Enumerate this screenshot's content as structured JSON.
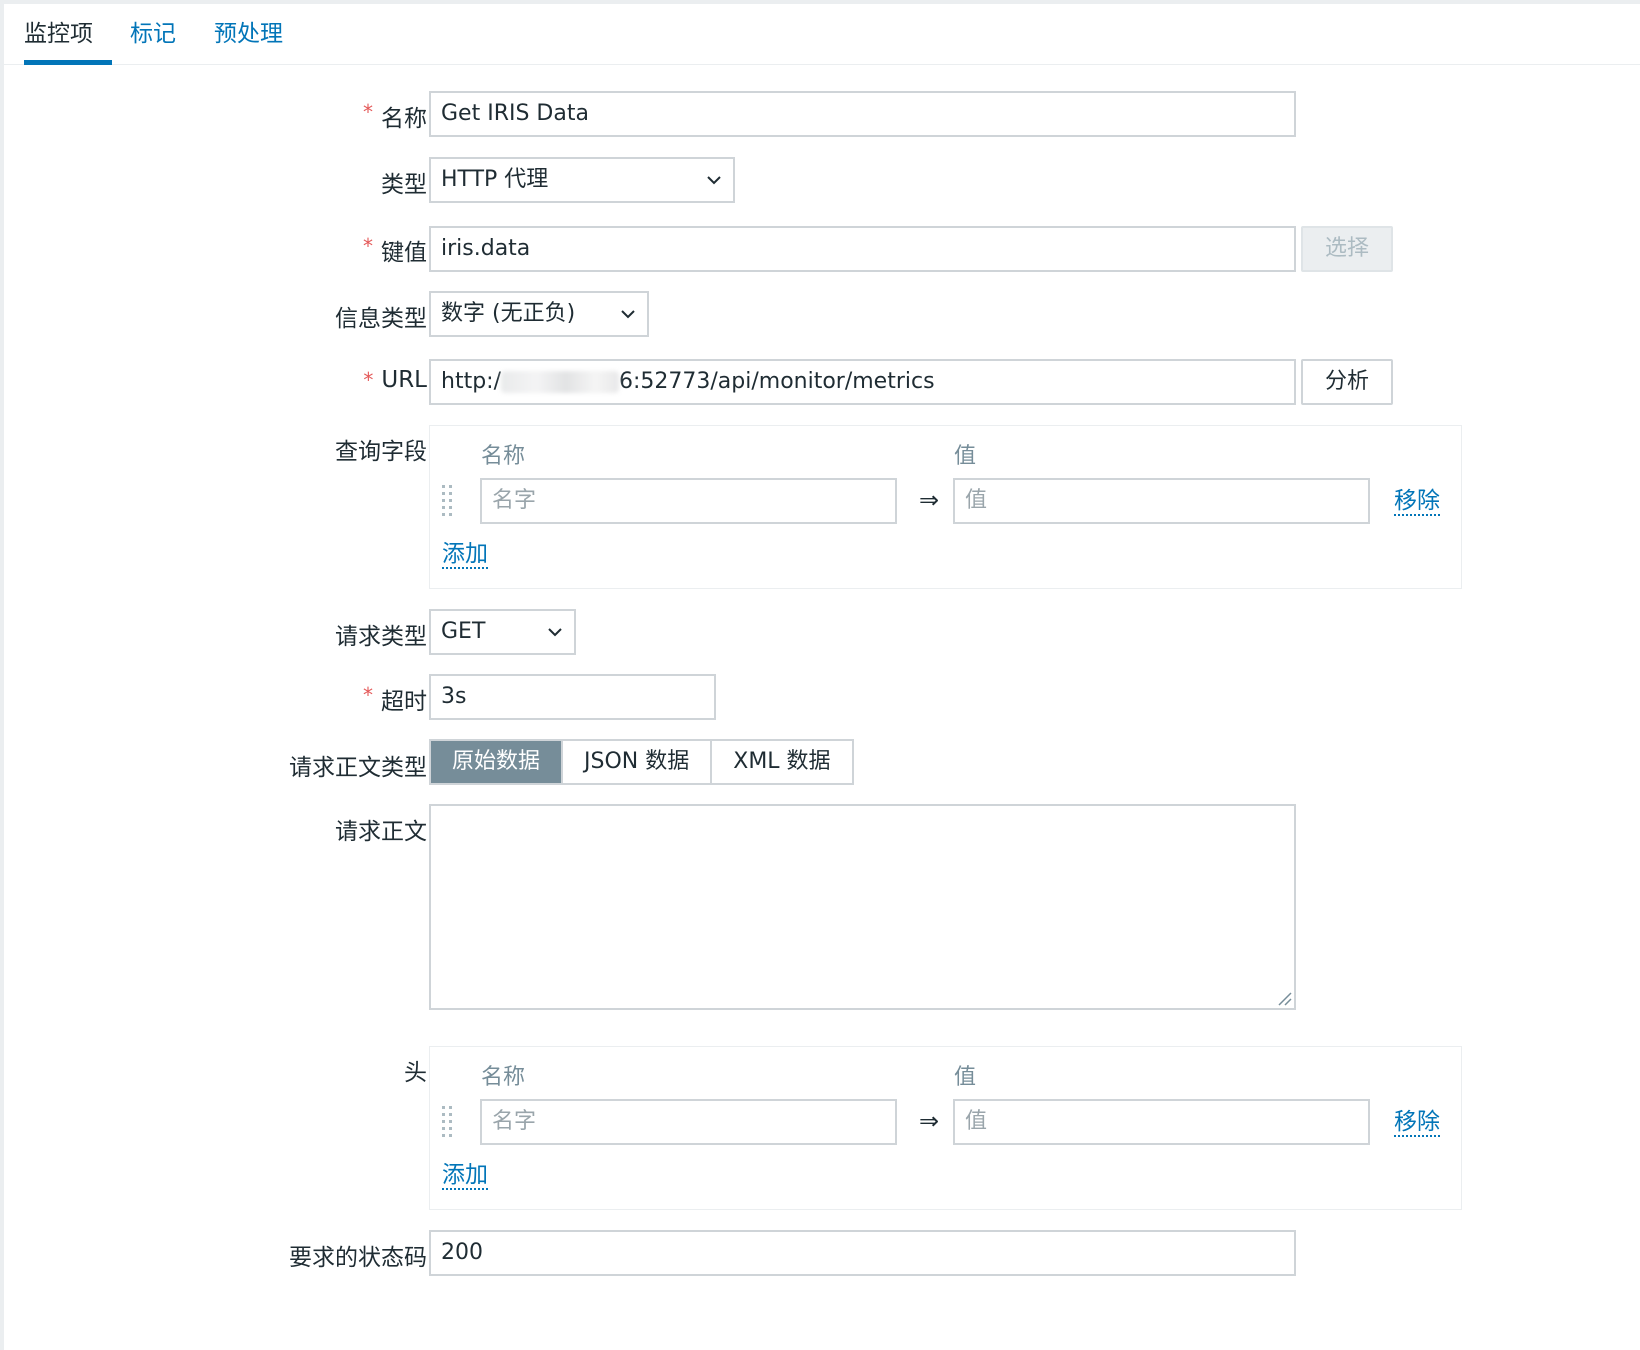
{
  "tabs": [
    {
      "label": "监控项",
      "active": true
    },
    {
      "label": "标记",
      "active": false
    },
    {
      "label": "预处理",
      "active": false
    }
  ],
  "form": {
    "name": {
      "label": "名称",
      "required": true,
      "value": "Get IRIS Data"
    },
    "type": {
      "label": "类型",
      "value": "HTTP 代理"
    },
    "key": {
      "label": "键值",
      "required": true,
      "value": "iris.data",
      "select_label": "选择"
    },
    "info_type": {
      "label": "信息类型",
      "value": "数字 (无正负)"
    },
    "url": {
      "label": "URL",
      "required": true,
      "value_prefix": "http:/",
      "value_suffix": "6:52773/api/monitor/metrics",
      "parse_label": "分析"
    },
    "query_fields": {
      "label": "查询字段",
      "col_name": "名称",
      "col_value": "值",
      "name_placeholder": "名字",
      "value_placeholder": "值",
      "remove_label": "移除",
      "add_label": "添加"
    },
    "request_type": {
      "label": "请求类型",
      "value": "GET"
    },
    "timeout": {
      "label": "超时",
      "required": true,
      "value": "3s"
    },
    "body_type": {
      "label": "请求正文类型",
      "options": [
        "原始数据",
        "JSON 数据",
        "XML 数据"
      ],
      "selected": "原始数据"
    },
    "body": {
      "label": "请求正文",
      "value": ""
    },
    "headers": {
      "label": "头",
      "col_name": "名称",
      "col_value": "值",
      "name_placeholder": "名字",
      "value_placeholder": "值",
      "remove_label": "移除",
      "add_label": "添加"
    },
    "status_codes": {
      "label": "要求的状态码",
      "value": "200"
    }
  },
  "colors": {
    "accent": "#0275b8",
    "required": "#e45959",
    "segment_active": "#768d99"
  },
  "icons": {
    "select_arrow": "chevron-down-icon",
    "drag_handle": "drag-handle-icon",
    "mapping_arrow": "⇒",
    "resize": "resize-handle-icon"
  }
}
